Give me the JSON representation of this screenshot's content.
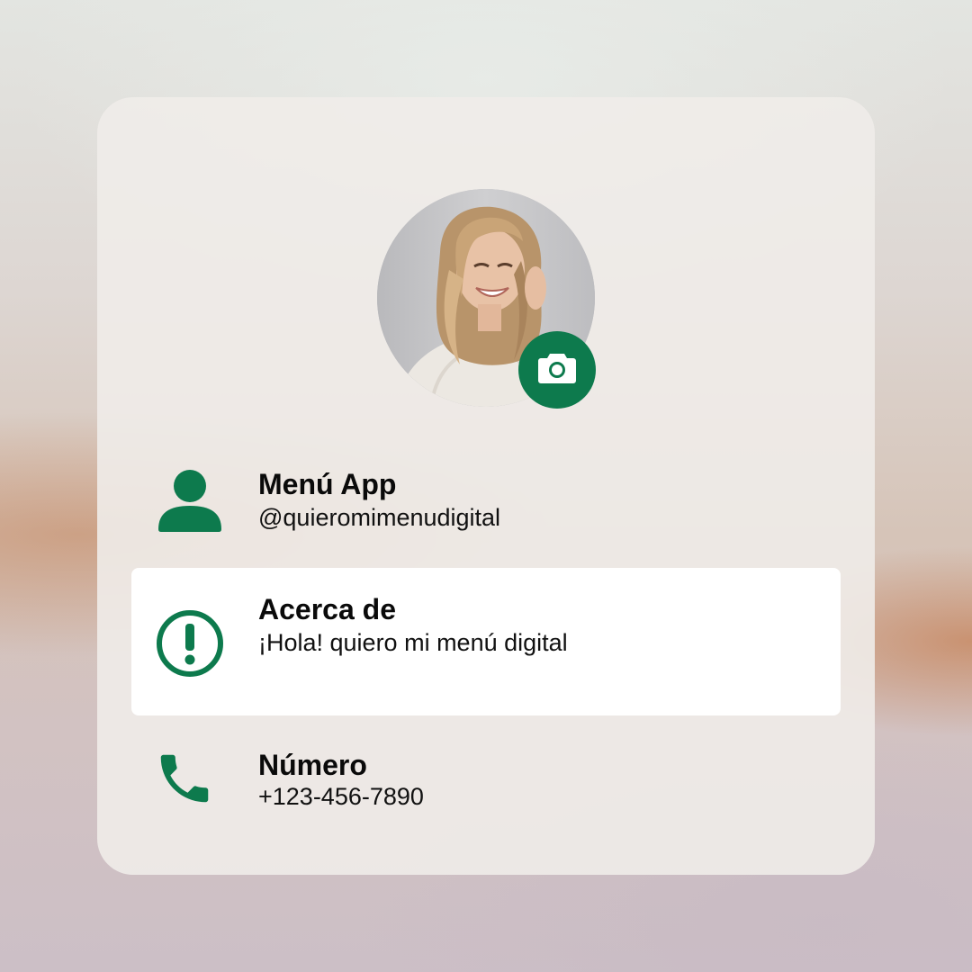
{
  "colors": {
    "accent": "#0d7a4d",
    "card_background": "#f0ece9",
    "highlight_row_background": "#ffffff"
  },
  "profile": {
    "avatar": "profile-photo",
    "camera_button_icon": "camera-icon"
  },
  "rows": [
    {
      "icon": "person-icon",
      "title": "Menú App",
      "subtitle": "@quieromimenudigital"
    },
    {
      "icon": "info-exclamation-icon",
      "title": "Acerca de",
      "subtitle": "¡Hola! quiero mi menú digital"
    },
    {
      "icon": "phone-icon",
      "title": "Número",
      "subtitle": "+123-456-7890"
    }
  ]
}
